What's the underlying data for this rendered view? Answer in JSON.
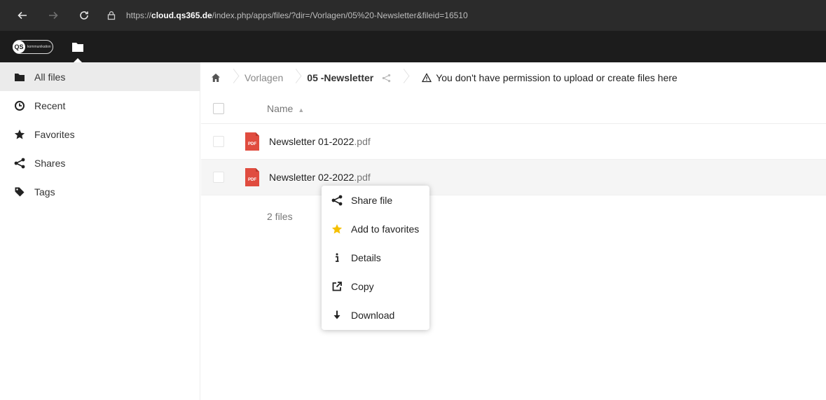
{
  "browser": {
    "url_prefix": "https://",
    "url_host": "cloud.qs365.de",
    "url_path": "/index.php/apps/files/?dir=/Vorlagen/05%20-Newsletter&fileid=16510"
  },
  "app": {
    "logo_badge": "QS",
    "logo_text": "kommunikation",
    "active_app": "Files"
  },
  "sidebar": {
    "items": [
      {
        "label": "All files",
        "icon": "folder-icon",
        "active": true
      },
      {
        "label": "Recent",
        "icon": "clock-icon",
        "active": false
      },
      {
        "label": "Favorites",
        "icon": "star-icon",
        "active": false
      },
      {
        "label": "Shares",
        "icon": "share-icon",
        "active": false
      },
      {
        "label": "Tags",
        "icon": "tag-icon",
        "active": false
      }
    ]
  },
  "breadcrumb": {
    "items": [
      "Vorlagen",
      "05 -Newsletter"
    ],
    "permission_warning": "You don't have permission to upload or create files here"
  },
  "table": {
    "name_header": "Name",
    "files": [
      {
        "base": "Newsletter 01-2022",
        "ext": ".pdf",
        "type": "PDF"
      },
      {
        "base": "Newsletter 02-2022",
        "ext": ".pdf",
        "type": "PDF"
      }
    ],
    "summary": "2 files"
  },
  "context_menu": {
    "items": [
      {
        "label": "Share file",
        "icon": "share-icon"
      },
      {
        "label": "Add to favorites",
        "icon": "star-icon"
      },
      {
        "label": "Details",
        "icon": "info-icon"
      },
      {
        "label": "Copy",
        "icon": "external-link-icon"
      },
      {
        "label": "Download",
        "icon": "download-icon"
      }
    ]
  },
  "colors": {
    "header_bg": "#1c1c1c",
    "pdf_red": "#e04c3f",
    "favorite_star": "#f5c000"
  }
}
